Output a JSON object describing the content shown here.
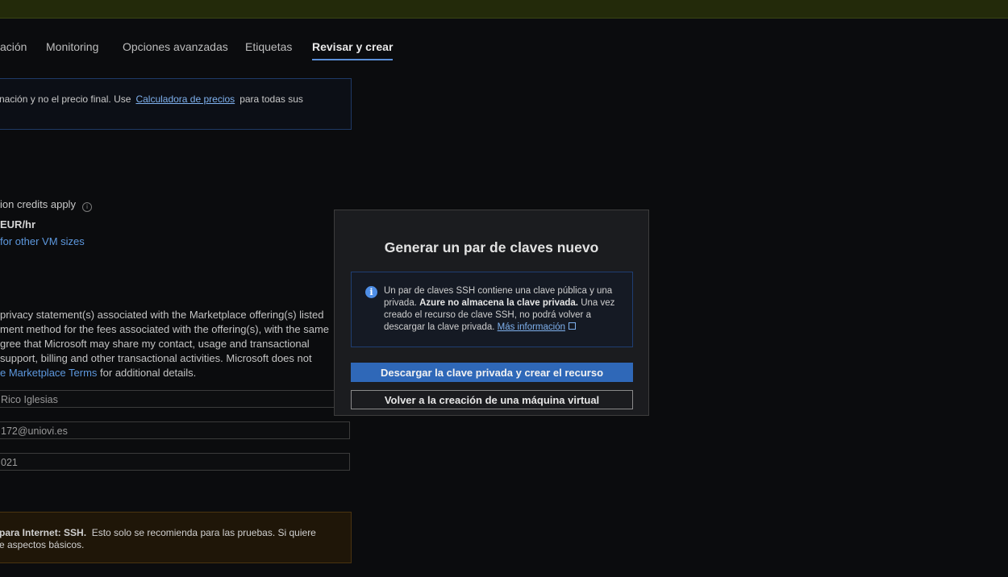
{
  "tabs": [
    {
      "label": "ación"
    },
    {
      "label": "Monitoring"
    },
    {
      "label": "Opciones avanzadas"
    },
    {
      "label": "Etiquetas"
    },
    {
      "label": "Revisar y crear"
    }
  ],
  "price_notice": {
    "text_before": "nación y no el precio final. Use",
    "link": "Calculadora de precios",
    "text_after": "para todas sus"
  },
  "pricing": {
    "credits": "ion credits apply",
    "price": "EUR/hr",
    "vm_sizes_link": "for other VM sizes"
  },
  "terms": {
    "line1": "privacy statement(s) associated with the Marketplace offering(s) listed",
    "line2": "ment method for the fees associated with the offering(s), with the same",
    "line3": "gree that Microsoft may share my contact, usage and transactional",
    "line4": "support, billing and other transactional activities. Microsoft does not",
    "link": "e Marketplace Terms",
    "line5_after": "for additional details."
  },
  "fields": {
    "name": "Rico Iglesias",
    "email": "172@uniovi.es",
    "phone": "021"
  },
  "warning": {
    "bold": "para Internet: SSH.",
    "text1": "Esto solo se recomienda para las pruebas.  Si quiere",
    "text2": "e aspectos básicos."
  },
  "dialog": {
    "title": "Generar un par de claves nuevo",
    "info_glyph": "i",
    "notice_part1": "Un par de claves SSH contiene una clave pública y una privada.",
    "notice_bold": "Azure no almacena la clave privada.",
    "notice_part2": "Una vez creado el recurso de clave SSH, no podrá volver a descargar la clave privada.",
    "more_info_link": "Más información",
    "primary_button": "Descargar la clave privada y crear el recurso",
    "secondary_button": "Volver a la creación de una máquina virtual"
  },
  "colors": {
    "accent": "#2f68b8",
    "link": "#5d98de",
    "background": "#0b0c0e",
    "topbar": "#232a0a",
    "warning_bg": "#1f1608"
  }
}
